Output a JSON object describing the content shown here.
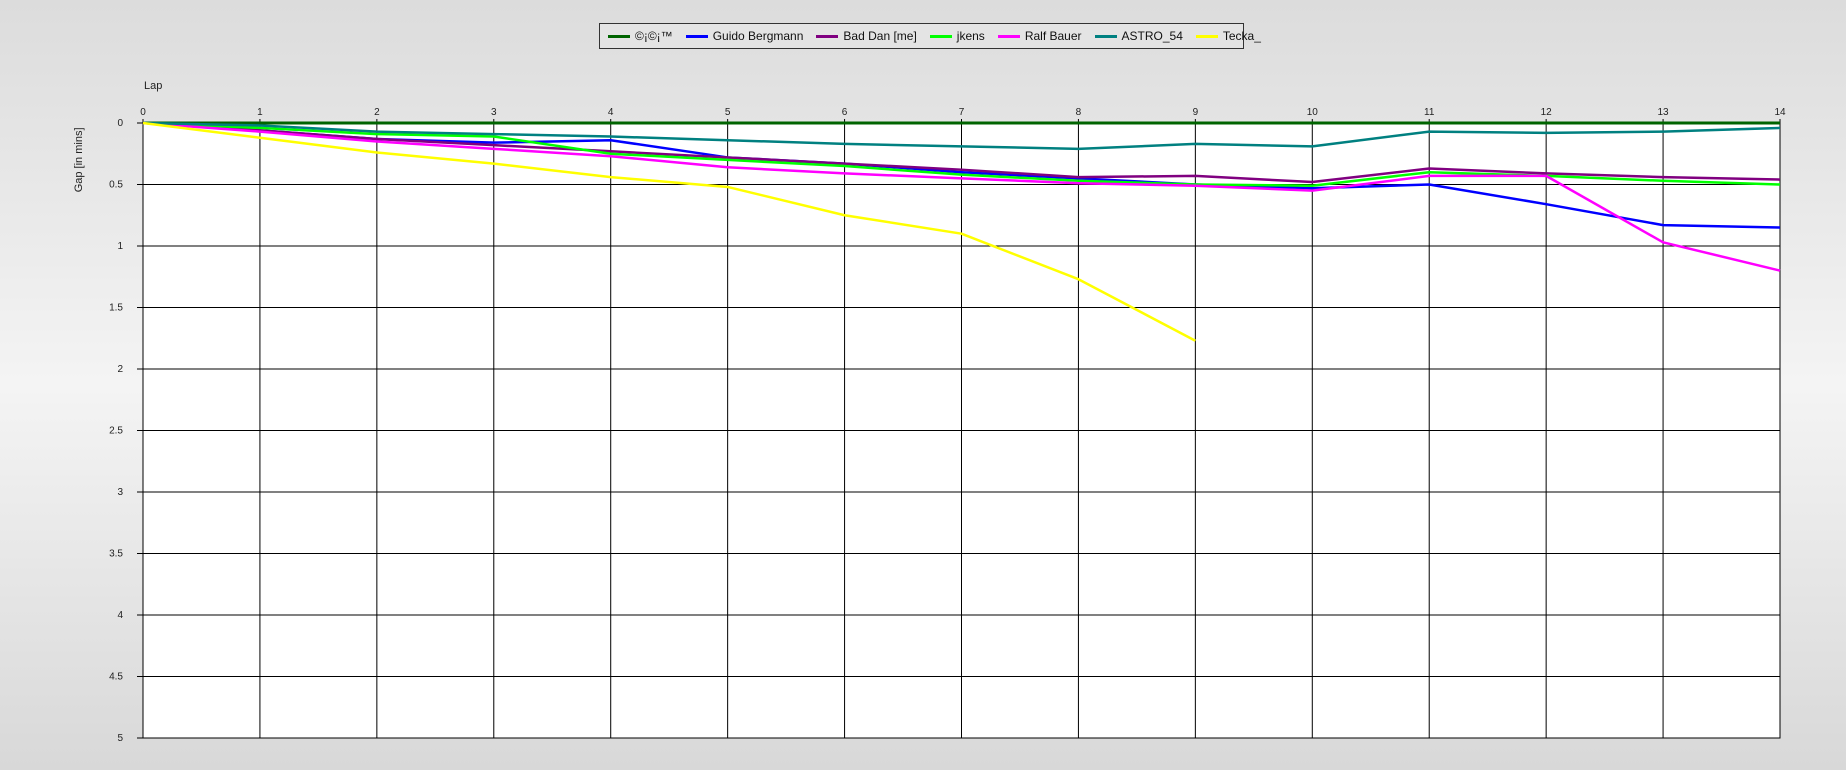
{
  "chart_data": {
    "type": "line",
    "title": "",
    "xlabel": "Lap",
    "ylabel": "Gap [in mins]",
    "x": [
      0,
      1,
      2,
      3,
      4,
      5,
      6,
      7,
      8,
      9,
      10,
      11,
      12,
      13,
      14
    ],
    "xlim": [
      0,
      14
    ],
    "ylim": [
      0,
      5
    ],
    "y_inverted": true,
    "xticks": [
      "0",
      "1",
      "2",
      "3",
      "4",
      "5",
      "6",
      "7",
      "8",
      "9",
      "10",
      "11",
      "12",
      "13",
      "14"
    ],
    "yticks": [
      "0",
      "0.5",
      "1",
      "1.5",
      "2",
      "2.5",
      "3",
      "3.5",
      "4",
      "4.5",
      "5"
    ],
    "ytick_values": [
      0,
      0.5,
      1,
      1.5,
      2,
      2.5,
      3,
      3.5,
      4,
      4.5,
      5
    ],
    "grid": true,
    "legend_position": "top-center",
    "series": [
      {
        "name": "©¡©¡™",
        "color": "#006400",
        "values": [
          0,
          0,
          0,
          0,
          0,
          0,
          0,
          0,
          0,
          0,
          0,
          0,
          0,
          0,
          0
        ]
      },
      {
        "name": "Guido Bergmann",
        "color": "#0000ff",
        "values": [
          0,
          0.06,
          0.13,
          0.16,
          0.14,
          0.28,
          0.33,
          0.4,
          0.45,
          0.5,
          0.53,
          0.5,
          0.66,
          0.83,
          0.85
        ]
      },
      {
        "name": "Bad Dan [me]",
        "color": "#800080",
        "values": [
          0,
          0.06,
          0.13,
          0.18,
          0.23,
          0.28,
          0.33,
          0.38,
          0.44,
          0.43,
          0.48,
          0.37,
          0.41,
          0.44,
          0.46
        ]
      },
      {
        "name": "jkens",
        "color": "#00ff00",
        "values": [
          0,
          0.04,
          0.09,
          0.11,
          0.25,
          0.3,
          0.35,
          0.42,
          0.47,
          0.5,
          0.51,
          0.4,
          0.43,
          0.47,
          0.5
        ]
      },
      {
        "name": "Ralf Bauer",
        "color": "#ff00ff",
        "values": [
          0,
          0.07,
          0.15,
          0.21,
          0.27,
          0.36,
          0.41,
          0.45,
          0.49,
          0.51,
          0.55,
          0.43,
          0.43,
          0.97,
          1.2
        ]
      },
      {
        "name": "ASTRO_54",
        "color": "#008080",
        "values": [
          0,
          0.02,
          0.07,
          0.09,
          0.11,
          0.14,
          0.17,
          0.19,
          0.21,
          0.17,
          0.19,
          0.07,
          0.08,
          0.07,
          0.04
        ]
      },
      {
        "name": "Tecka_",
        "color": "#ffff00",
        "values": [
          0,
          0.12,
          0.24,
          0.33,
          0.44,
          0.52,
          0.75,
          0.9,
          1.27,
          1.77,
          null,
          null,
          null,
          null,
          null
        ]
      }
    ]
  }
}
